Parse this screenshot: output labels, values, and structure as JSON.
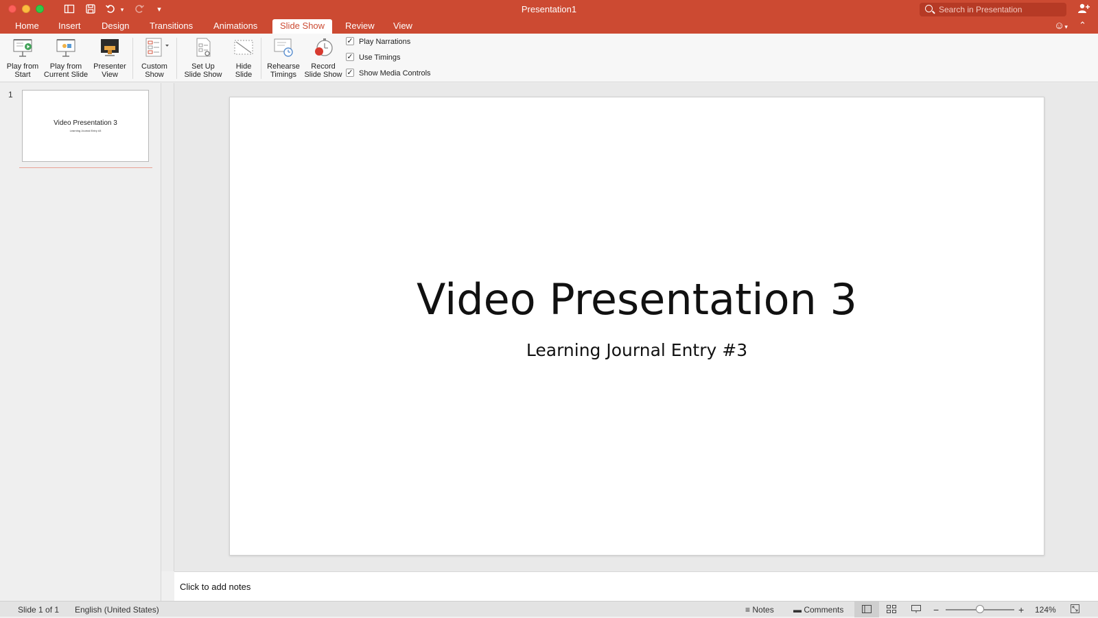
{
  "window": {
    "title": "Presentation1"
  },
  "search": {
    "placeholder": "Search in Presentation"
  },
  "tabs": [
    "Home",
    "Insert",
    "Design",
    "Transitions",
    "Animations",
    "Slide Show",
    "Review",
    "View"
  ],
  "active_tab": "Slide Show",
  "ribbon": {
    "play_from_start": "Play from\nStart",
    "play_from_current": "Play from\nCurrent Slide",
    "presenter_view": "Presenter\nView",
    "custom_show": "Custom\nShow",
    "set_up": "Set Up\nSlide Show",
    "hide_slide": "Hide\nSlide",
    "rehearse": "Rehearse\nTimings",
    "record": "Record\nSlide Show",
    "checkboxes": [
      {
        "label": "Play Narrations",
        "checked": true
      },
      {
        "label": "Use Timings",
        "checked": true
      },
      {
        "label": "Show Media Controls",
        "checked": true
      }
    ]
  },
  "thumbnails": [
    {
      "number": "1",
      "title": "Video Presentation 3",
      "subtitle": "Learning Journal Entry #3"
    }
  ],
  "slide": {
    "title": "Video Presentation 3",
    "subtitle": "Learning Journal Entry #3"
  },
  "notes": {
    "placeholder": "Click to add notes"
  },
  "status": {
    "slide_count": "Slide 1 of 1",
    "language": "English (United States)",
    "notes_label": "Notes",
    "comments_label": "Comments",
    "zoom": "124%"
  },
  "colors": {
    "accent": "#cc4a32"
  }
}
